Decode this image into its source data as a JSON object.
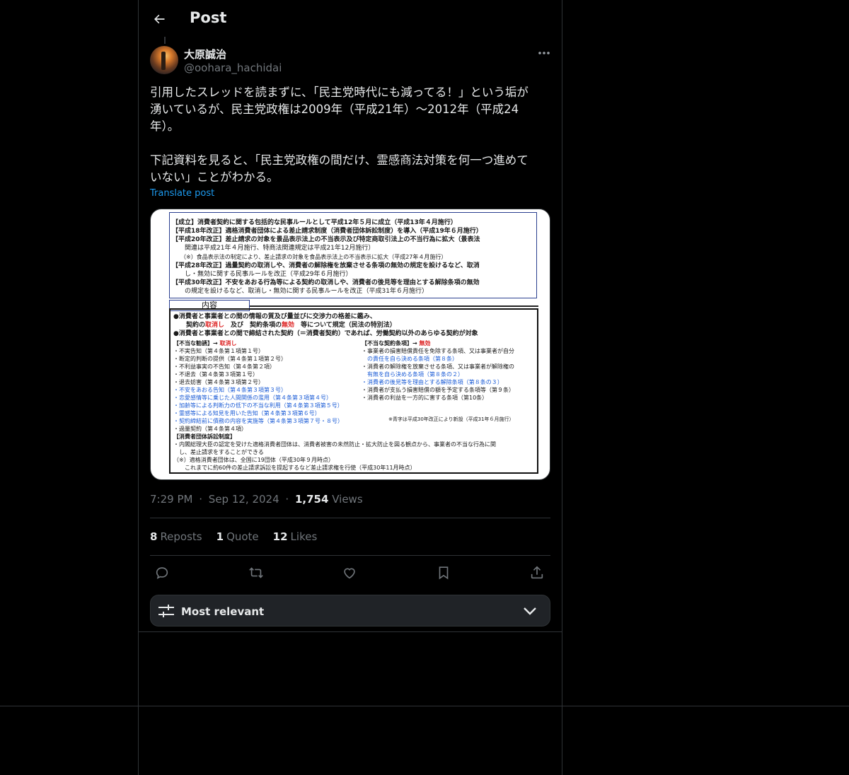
{
  "header": {
    "title": "Post"
  },
  "author": {
    "display_name": "大原誠治",
    "handle": "@oohara_hachidai"
  },
  "post": {
    "text_lines": [
      "引用したスレッドを読まずに、「民主党時代にも減ってる！」という垢が",
      "湧いているが、民主党政権は2009年（平成21年）〜2012年（平成24",
      "年）。",
      "",
      "下記資料を見ると、「民主党政権の間だけ、霊感商法対策を何一つ進めて",
      "いない」ことがわかる。"
    ],
    "translate_label": "Translate post"
  },
  "meta": {
    "time": "7:29 PM",
    "date": "Sep 12, 2024",
    "views_count": "1,754",
    "views_label": "Views",
    "sep": "·"
  },
  "stats": [
    {
      "count": "8",
      "label": "Reposts"
    },
    {
      "count": "1",
      "label": "Quote"
    },
    {
      "count": "12",
      "label": "Likes"
    }
  ],
  "sort": {
    "label": "Most relevant"
  },
  "image_doc": {
    "box1_lines": [
      "【成立】消費者契約に関する包括的な民事ルールとして平成12年５月に成立（平成13年４月施行）",
      "【平成18年改正】適格消費者団体による差止請求制度（消費者団体訴訟制度）を導入（平成19年６月施行）",
      "【平成20年改正】差止請求の対象を景品表示法上の不当表示及び特定商取引法上の不当行為に拡大（景表法",
      "　　関連は平成21年４月施行、特商法関連規定は平成21年12月施行）",
      "　　（※）食品表示法の制定により、差止請求の対象を食品表示法上の不当表示に拡大（平成27年４月施行）",
      "【平成28年改正】過量契約の取消しや、消費者の解除権を放棄させる条項の無効の規定を設けるなど、取消",
      "　　し・無効に関する民事ルールを改正（平成29年６月施行）",
      "【平成30年改正】不安をあおる行為等による契約の取消しや、消費者の後見等を理由とする解除条項の無効",
      "　　の規定を設けるなど、取消し・無効に関する民事ルールを改正（平成31年６月施行）"
    ],
    "tab_label": "内容",
    "box2_lines": [
      "●消費者と事業者との間の情報の質及び量並びに交渉力の格差に鑑み、",
      "　　契約の取消し　及び　契約条項の無効　等について規定（民法の特別法）",
      "●消費者と事業者との間で締結された契約（＝消費者契約）であれば、労働契約以外のあらゆる契約が対象"
    ],
    "left_col": [
      "【不当な勧誘】→ 取消し",
      "・不実告知（第４条第１項第１号）",
      "・断定的判断の提供（第４条第１項第２号）",
      "・不利益事実の不告知（第４条第２項）",
      "・不退去（第４条第３項第１号）",
      "・退去妨害（第４条第３項第２号）",
      "・不安をあおる告知（第４条第３項第３号）",
      "・恋愛感情等に乗じた人間関係の濫用（第４条第３項第４号）",
      "・加齢等による判断力の低下の不当な利用（第４条第３項第５号）",
      "・霊感等による知見を用いた告知（第４条第３項第６号）",
      "・契約締結前に債務の内容を実施等（第４条第３項第７号・８号）",
      "・過量契約（第４条第４項）"
    ],
    "right_col": [
      "【不当な契約条項】→ 無効",
      "・事業者の損害賠償責任を免除する条項、又は事業者が自分",
      "　の責任を自ら決める条項（第８条）",
      "・消費者の解除権を放棄させる条項、又は事業者が解除権の",
      "　有無を自ら決める条項（第８条の２）",
      "・消費者の後見等を理由とする解除条項（第８条の３）",
      "・消費者が支払う損害賠償の額を予定する条項等（第９条）",
      "・消費者の利益を一方的に害する条項（第10条）"
    ],
    "note": "※青字は平成30年改正により新設（平成31年６月施行）",
    "footer_lines": [
      "【消費者団体訴訟制度】",
      "・内閣総理大臣の認定を受けた適格消費者団体は、消費者被害の未然防止・拡大防止を図る観点から、事業者の不当な行為に関",
      "　し、差止請求をすることができる",
      "（※）適格消費者団体は、全国に19団体（平成30年９月時点）",
      "　　これまでに約60件の差止請求訴訟を提起するなど差止請求権を行使（平成30年11月時点）"
    ]
  }
}
